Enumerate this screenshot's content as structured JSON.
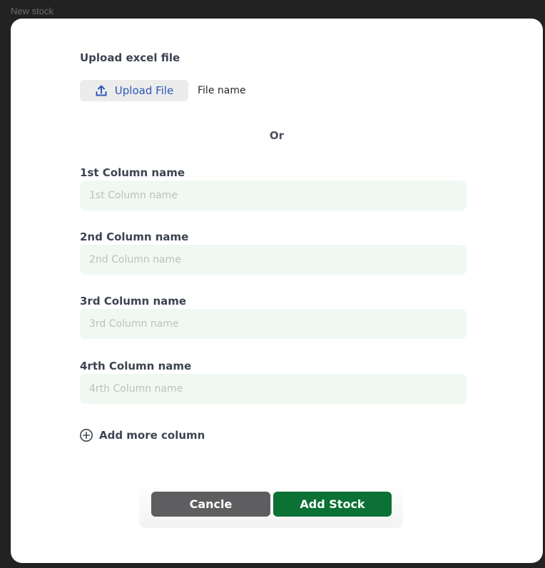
{
  "window": {
    "title": "New stock"
  },
  "upload": {
    "section_label": "Upload excel file",
    "button_label": "Upload File",
    "file_name": "File name"
  },
  "divider": {
    "text": "Or"
  },
  "fields": [
    {
      "label": "1st Column name",
      "placeholder": "1st Column name",
      "value": ""
    },
    {
      "label": "2nd Column name",
      "placeholder": "2nd Column name",
      "value": ""
    },
    {
      "label": "3rd Column name",
      "placeholder": "3rd Column name",
      "value": ""
    },
    {
      "label": "4rth Column name",
      "placeholder": "4rth Column name",
      "value": ""
    }
  ],
  "add_more": {
    "label": "Add more column",
    "icon": "plus-circle-icon"
  },
  "actions": {
    "cancel_label": "Cancle",
    "submit_label": "Add Stock"
  },
  "colors": {
    "accent_primary": "#0b7135",
    "button_secondary": "#5e5e60",
    "upload_text": "#2e58b8",
    "input_background": "#eff9f2"
  }
}
